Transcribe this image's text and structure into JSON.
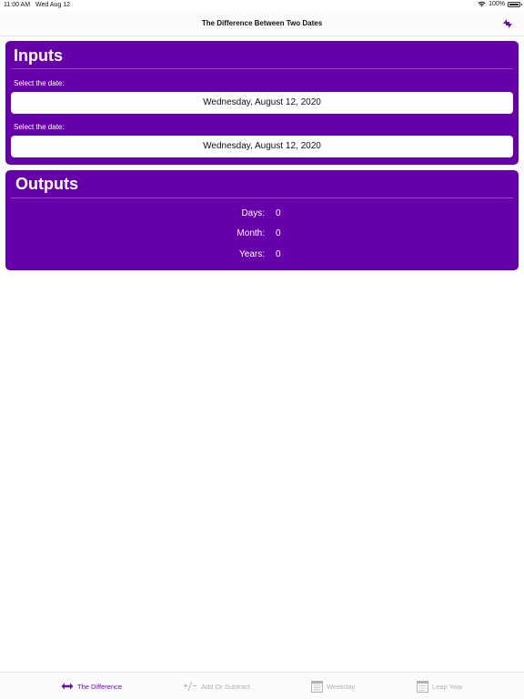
{
  "status_bar": {
    "time": "11:00 AM",
    "date": "Wed Aug 12",
    "battery": "100%"
  },
  "nav": {
    "title": "The Difference Between Two Dates",
    "swap_icon": "swap-arrows-icon"
  },
  "inputs": {
    "title": "Inputs",
    "field1_label": "Select the date:",
    "field1_value": "Wednesday, August 12, 2020",
    "field2_label": "Select the date:",
    "field2_value": "Wednesday, August 12, 2020"
  },
  "outputs": {
    "title": "Outputs",
    "rows": [
      {
        "label": "Days:",
        "value": "0"
      },
      {
        "label": "Month:",
        "value": "0"
      },
      {
        "label": "Years:",
        "value": "0"
      }
    ]
  },
  "tabs": [
    {
      "label": "The Difference",
      "icon": "double-arrow-icon",
      "active": true
    },
    {
      "label": "Add Or Subtract",
      "icon": "plus-minus-icon",
      "active": false
    },
    {
      "label": "Weekday",
      "icon": "calendar-icon",
      "active": false
    },
    {
      "label": "Leap Year",
      "icon": "calendar-icon",
      "active": false
    }
  ],
  "colors": {
    "accent": "#6600a8",
    "tab_active": "#6a0dad",
    "tab_inactive": "#b2b2b2"
  }
}
